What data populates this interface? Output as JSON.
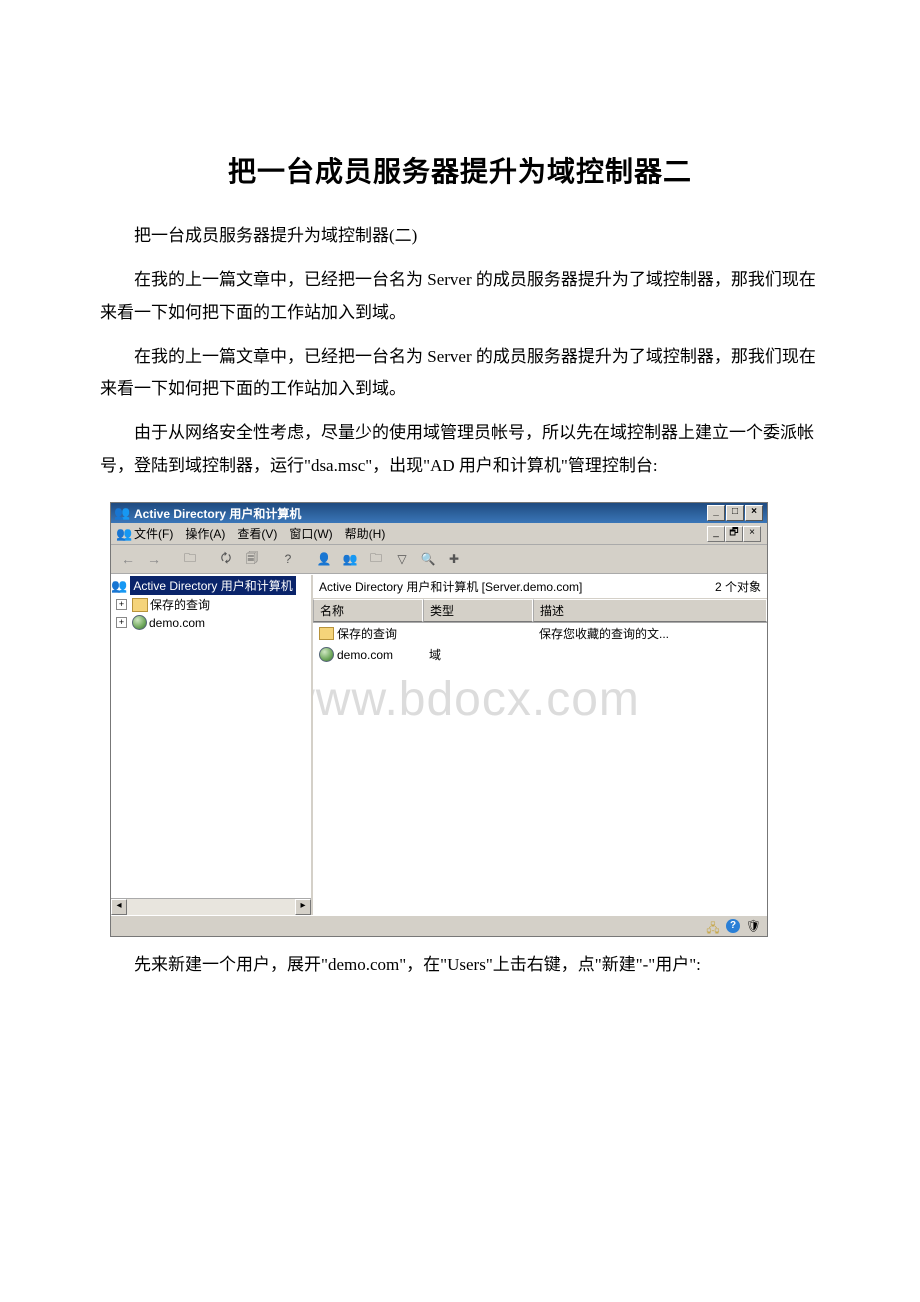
{
  "doc": {
    "title": "把一台成员服务器提升为域控制器二",
    "p1": "把一台成员服务器提升为域控制器(二)",
    "p2": "在我的上一篇文章中，已经把一台名为 Server 的成员服务器提升为了域控制器，那我们现在来看一下如何把下面的工作站加入到域。",
    "p3": "在我的上一篇文章中，已经把一台名为 Server 的成员服务器提升为了域控制器，那我们现在来看一下如何把下面的工作站加入到域。",
    "p4": "由于从网络安全性考虑，尽量少的使用域管理员帐号，所以先在域控制器上建立一个委派帐号，登陆到域控制器，运行\"dsa.msc\"，出现\"AD 用户和计算机\"管理控制台:",
    "p5": "先来新建一个用户，展开\"demo.com\"，在\"Users\"上击右键，点\"新建\"-\"用户\":"
  },
  "win": {
    "title": "Active Directory 用户和计算机",
    "menu": {
      "file": "文件(F)",
      "action": "操作(A)",
      "view": "查看(V)",
      "window": "窗口(W)",
      "help": "帮助(H)"
    },
    "tree": {
      "root": "Active Directory 用户和计算机",
      "saved_queries": "保存的查询",
      "domain": "demo.com"
    },
    "list": {
      "caption": "Active Directory 用户和计算机 [Server.demo.com]",
      "count": "2 个对象",
      "cols": {
        "name": "名称",
        "type": "类型",
        "desc": "描述"
      },
      "rows": [
        {
          "name": "保存的查询",
          "type": "",
          "desc": "保存您收藏的查询的文..."
        },
        {
          "name": "demo.com",
          "type": "域",
          "desc": ""
        }
      ]
    }
  },
  "watermark": "www.bdocx.com"
}
